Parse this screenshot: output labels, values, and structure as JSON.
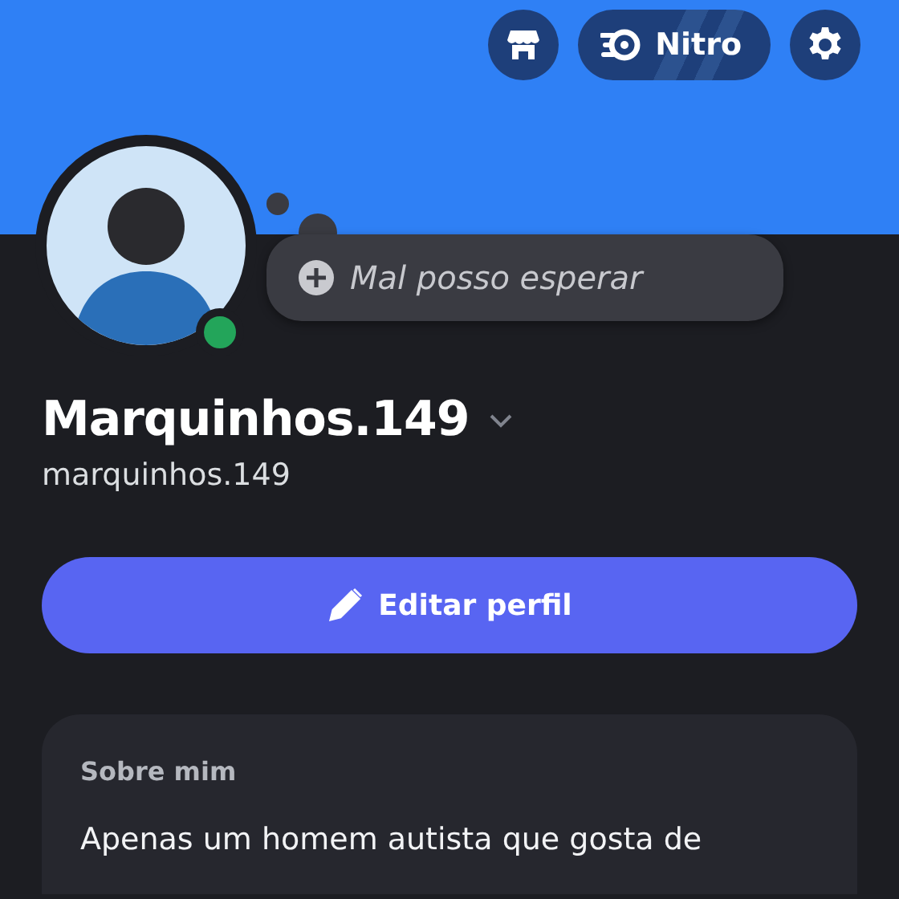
{
  "top_actions": [
    {
      "kind": "shop"
    },
    {
      "kind": "nitro",
      "label": "Nitro"
    },
    {
      "kind": "settings"
    }
  ],
  "avatar": {
    "online": true
  },
  "custom_status": {
    "placeholder": "Mal posso esperar"
  },
  "display_name": "Marquinhos.149",
  "username": "marquinhos.149",
  "edit_button": {
    "label": "Editar perfil"
  },
  "about": {
    "heading": "Sobre mim",
    "text": "Apenas um homem autista que gosta de"
  }
}
